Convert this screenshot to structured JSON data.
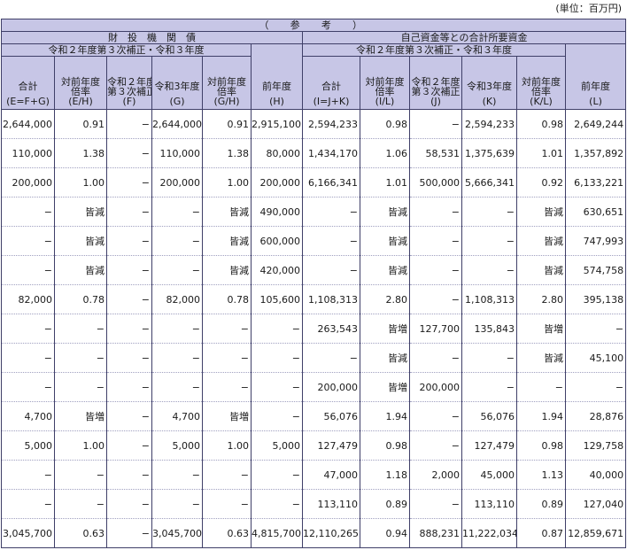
{
  "unit_label": "(単位：百万円)",
  "header": {
    "top": "（　参　考　）",
    "group_left": "財　投　機　関　債",
    "group_right": "自己資金等との合計所要資金",
    "sub_left": "令和２年度第３次補正・令和３年度",
    "sub_right": "令和２年度第３次補正・令和３年度",
    "cols": [
      [
        "合計",
        "(E=F+G)"
      ],
      [
        "対前年度",
        "倍率",
        "(E/H)"
      ],
      [
        "令和２年度",
        "第３次補正",
        "(F)"
      ],
      [
        "令和3年度",
        "(G)"
      ],
      [
        "対前年度",
        "倍率",
        "(G/H)"
      ],
      [
        "前年度",
        "(H)"
      ],
      [
        "合計",
        "(I=J+K)"
      ],
      [
        "対前年度",
        "倍率",
        "(I/L)"
      ],
      [
        "令和２年度",
        "第３次補正",
        "(J)"
      ],
      [
        "令和3年度",
        "(K)"
      ],
      [
        "対前年度",
        "倍率",
        "(K/L)"
      ],
      [
        "前年度",
        "(L)"
      ]
    ]
  },
  "rows": [
    [
      "2,644,000",
      "0.91",
      "−",
      "2,644,000",
      "0.91",
      "2,915,100",
      "2,594,233",
      "0.98",
      "−",
      "2,594,233",
      "0.98",
      "2,649,244"
    ],
    [
      "110,000",
      "1.38",
      "−",
      "110,000",
      "1.38",
      "80,000",
      "1,434,170",
      "1.06",
      "58,531",
      "1,375,639",
      "1.01",
      "1,357,892"
    ],
    [
      "200,000",
      "1.00",
      "−",
      "200,000",
      "1.00",
      "200,000",
      "6,166,341",
      "1.01",
      "500,000",
      "5,666,341",
      "0.92",
      "6,133,221"
    ],
    [
      "−",
      "皆減",
      "−",
      "−",
      "皆減",
      "490,000",
      "−",
      "皆減",
      "−",
      "−",
      "皆減",
      "630,651"
    ],
    [
      "−",
      "皆減",
      "−",
      "−",
      "皆減",
      "600,000",
      "−",
      "皆減",
      "−",
      "−",
      "皆減",
      "747,993"
    ],
    [
      "−",
      "皆減",
      "−",
      "−",
      "皆減",
      "420,000",
      "−",
      "皆減",
      "−",
      "−",
      "皆減",
      "574,758"
    ],
    [
      "82,000",
      "0.78",
      "−",
      "82,000",
      "0.78",
      "105,600",
      "1,108,313",
      "2.80",
      "−",
      "1,108,313",
      "2.80",
      "395,138"
    ],
    [
      "−",
      "−",
      "−",
      "−",
      "−",
      "−",
      "263,543",
      "皆増",
      "127,700",
      "135,843",
      "皆増",
      "−"
    ],
    [
      "−",
      "−",
      "−",
      "−",
      "−",
      "−",
      "−",
      "皆減",
      "−",
      "−",
      "皆減",
      "45,100"
    ],
    [
      "−",
      "−",
      "−",
      "−",
      "−",
      "−",
      "200,000",
      "皆増",
      "200,000",
      "−",
      "−",
      "−"
    ],
    [
      "4,700",
      "皆増",
      "−",
      "4,700",
      "皆増",
      "−",
      "56,076",
      "1.94",
      "−",
      "56,076",
      "1.94",
      "28,876"
    ],
    [
      "5,000",
      "1.00",
      "−",
      "5,000",
      "1.00",
      "5,000",
      "127,479",
      "0.98",
      "−",
      "127,479",
      "0.98",
      "129,758"
    ],
    [
      "−",
      "−",
      "−",
      "−",
      "−",
      "−",
      "47,000",
      "1.18",
      "2,000",
      "45,000",
      "1.13",
      "40,000"
    ],
    [
      "−",
      "−",
      "−",
      "−",
      "−",
      "−",
      "113,110",
      "0.89",
      "−",
      "113,110",
      "0.89",
      "127,040"
    ],
    [
      "3,045,700",
      "0.63",
      "−",
      "3,045,700",
      "0.63",
      "4,815,700",
      "12,110,265",
      "0.94",
      "888,231",
      "11,222,034",
      "0.87",
      "12,859,671"
    ]
  ]
}
